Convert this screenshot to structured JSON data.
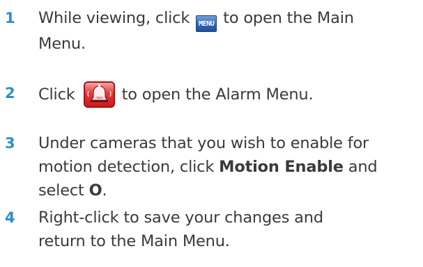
{
  "steps": [
    {
      "number": "1",
      "text_before": "While viewing, click",
      "icon_label": "MENU",
      "text_after": "to open the Main",
      "text_line2": "Menu."
    },
    {
      "number": "2",
      "text_before": "Click",
      "icon_label": "Alarm",
      "text_after": "to open the Alarm Menu."
    },
    {
      "number": "3",
      "line1": "Under cameras that you wish to enable for",
      "line2_before": "motion detection, click",
      "line2_bold": "Motion Enable",
      "line2_after": "and",
      "line3_before": "select",
      "line3_bold": "O",
      "line3_after": "."
    },
    {
      "number": "4",
      "line1": "Right-click to save your changes and",
      "line2": "return to the Main Menu."
    }
  ],
  "colors": {
    "step_number": "#2a8fc9",
    "body_text": "#3a3a3a",
    "menu_icon": "#2f63b0",
    "alarm_icon": "#e23a3a"
  }
}
